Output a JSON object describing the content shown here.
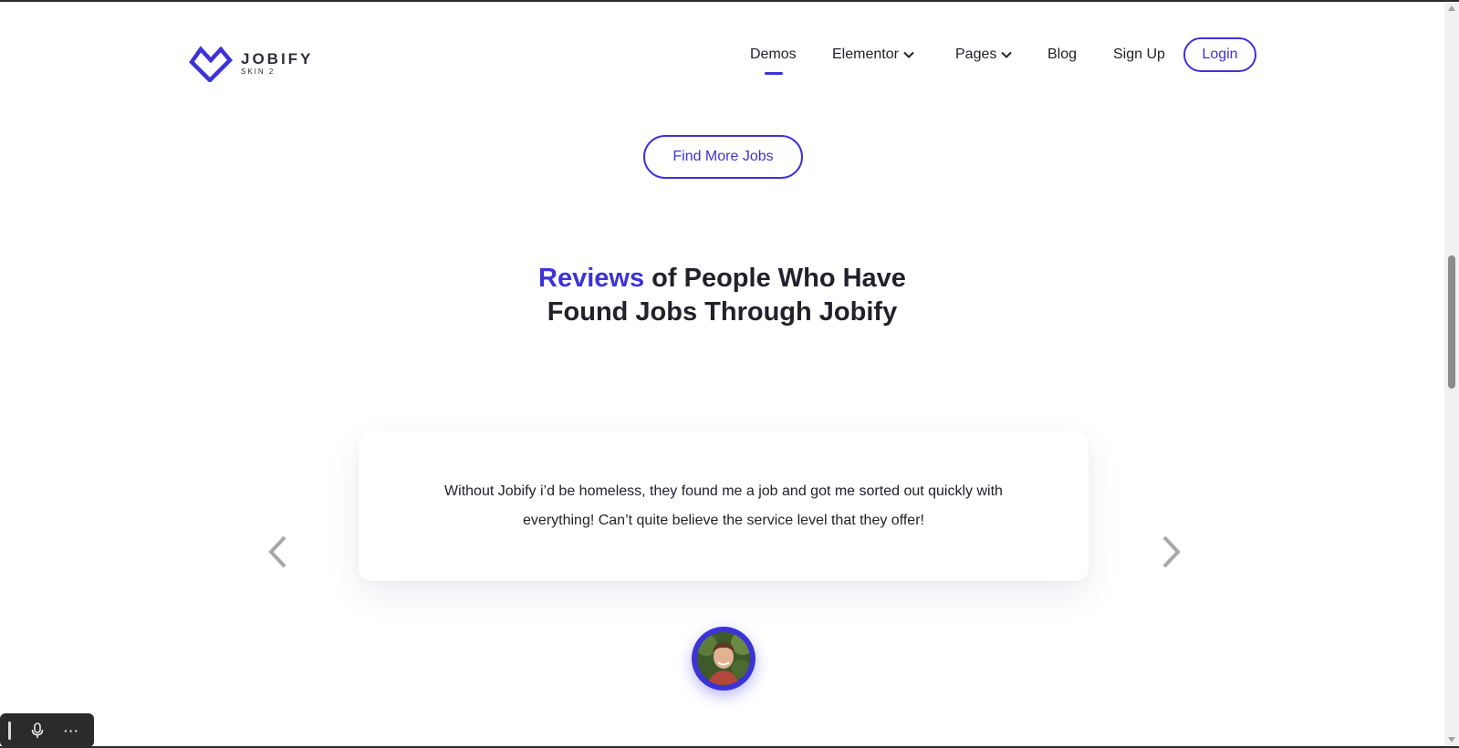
{
  "header": {
    "logo": {
      "name": "JOBIFY",
      "sub": "SKIN 2"
    },
    "nav": [
      {
        "label": "Demos",
        "dropdown": false,
        "active": true
      },
      {
        "label": "Elementor",
        "dropdown": true
      },
      {
        "label": "Pages",
        "dropdown": true
      },
      {
        "label": "Blog",
        "dropdown": false
      },
      {
        "label": "Sign Up",
        "dropdown": false
      }
    ],
    "login_label": "Login"
  },
  "main": {
    "find_more_label": "Find More Jobs",
    "heading": {
      "accent": "Reviews",
      "line1_rest": " of People Who Have",
      "line2": "Found Jobs Through Jobify"
    },
    "review": {
      "text": "Without Jobify i’d be homeless, they found me a job and got me sorted out quickly with everything! Can’t quite believe the service level that they offer!"
    },
    "carousel": {
      "prev_icon": "chevron-left-icon",
      "next_icon": "chevron-right-icon"
    }
  },
  "toolbar": {
    "more_label": "···"
  },
  "colors": {
    "accent": "#3c33d6",
    "text": "#22212b",
    "arrow": "#a7a7a7"
  }
}
